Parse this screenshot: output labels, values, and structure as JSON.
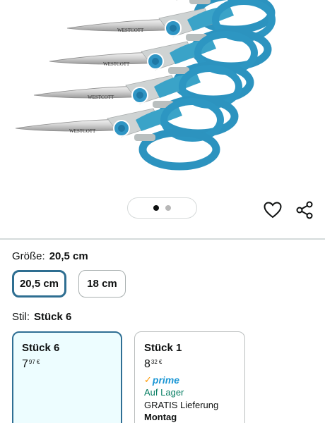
{
  "product": {
    "image_alt": "Westcott Schere Set",
    "brand_engraving": "WESTCOTT",
    "handle_print": "Westcott",
    "handle_color": "#3aa3c8",
    "carousel": {
      "total": 2,
      "active_index": 0
    }
  },
  "actions": {
    "wishlist_icon": "heart-icon",
    "share_icon": "share-icon"
  },
  "size": {
    "label": "Größe:",
    "selected_value": "20,5 cm",
    "options": [
      {
        "label": "20,5 cm",
        "selected": true
      },
      {
        "label": "18 cm",
        "selected": false
      }
    ]
  },
  "style": {
    "label": "Stil:",
    "selected_value": "Stück 6",
    "options": [
      {
        "title": "Stück 6",
        "price_whole": "7",
        "price_fraction": "97",
        "currency": "€",
        "selected": true
      },
      {
        "title": "Stück 1",
        "price_whole": "8",
        "price_fraction": "32",
        "currency": "€",
        "selected": false,
        "prime": "prime",
        "stock": "Auf Lager",
        "delivery": "GRATIS Lieferung",
        "delivery_day": "Montag"
      }
    ]
  },
  "colors": {
    "accent_border": "#2e6e91",
    "selected_bg": "#edfdff",
    "in_stock": "#067d62",
    "prime_blue": "#1c97d5",
    "prime_check": "#ff9900"
  }
}
